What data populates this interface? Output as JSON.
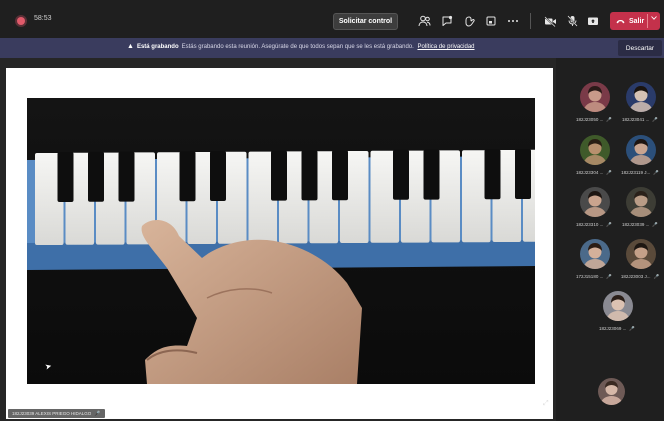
{
  "meeting": {
    "timer": "58:53",
    "request_control_label": "Solicitar control",
    "leave_label": "Salir"
  },
  "recording_banner": {
    "title": "Está grabando",
    "message": "Estás grabando esta reunión. Asegúrate de que todos sepan que se les está grabando.",
    "privacy_link": "Política de privacidad",
    "dismiss_label": "Descartar"
  },
  "stage": {
    "presenter_name": "182J23039 ALEXIS PRIEGO HIDALGO"
  },
  "participants": [
    {
      "name": "182J23050 ..."
    },
    {
      "name": "182J23041 ..."
    },
    {
      "name": "182J23304 ..."
    },
    {
      "name": "182J23119 J..."
    },
    {
      "name": "182J23310 ..."
    },
    {
      "name": "182J23039 ..."
    },
    {
      "name": "172J15180 ..."
    },
    {
      "name": "182J23003 J..."
    },
    {
      "name": "182J23069 ..."
    }
  ],
  "colors": {
    "accent": "#c4314b",
    "banner": "#3a3c5e",
    "topbar": "#1f1f1f"
  },
  "icons": [
    "recording-dot-icon",
    "participants-icon",
    "chat-icon",
    "reactions-icon",
    "rooms-icon",
    "more-icon",
    "camera-off-icon",
    "mic-off-icon",
    "share-icon",
    "phone-icon",
    "chevron-down-icon",
    "warning-icon",
    "mic-off-small-icon",
    "expand-icon",
    "cursor-icon"
  ]
}
